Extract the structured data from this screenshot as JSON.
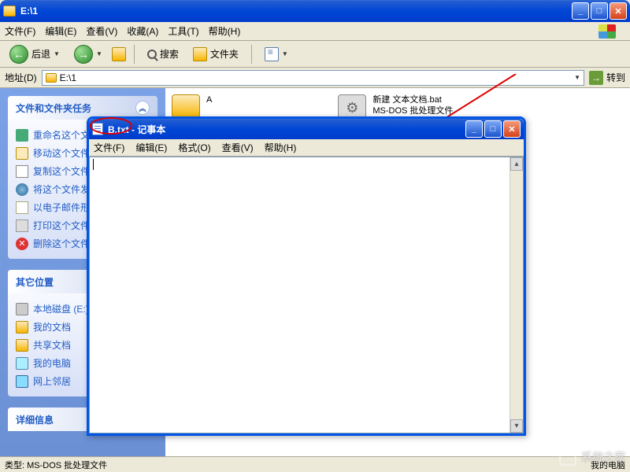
{
  "explorer": {
    "title": "E:\\1",
    "menus": [
      "文件(F)",
      "编辑(E)",
      "查看(V)",
      "收藏(A)",
      "工具(T)",
      "帮助(H)"
    ],
    "toolbar": {
      "back": "后退",
      "search": "搜索",
      "folders": "文件夹"
    },
    "address": {
      "label": "地址(D)",
      "value": "E:\\1",
      "go": "转到"
    },
    "sidebar": {
      "tasks": {
        "title": "文件和文件夹任务",
        "items": [
          "重命名这个文件",
          "移动这个文件",
          "复制这个文件",
          "将这个文件发布到 Web",
          "以电子邮件形式发送此文件",
          "打印这个文件",
          "删除这个文件"
        ]
      },
      "other": {
        "title": "其它位置",
        "items": [
          "本地磁盘 (E:)",
          "我的文档",
          "共享文档",
          "我的电脑",
          "网上邻居"
        ]
      },
      "details": {
        "title": "详细信息"
      }
    },
    "files": {
      "folder_a": "A",
      "bat_line1": "新建 文本文档.bat",
      "bat_line2": "MS-DOS 批处理文件"
    },
    "status": {
      "left": "类型: MS-DOS 批处理文件",
      "right": "我的电脑"
    }
  },
  "notepad": {
    "title": "B.txt - 记事本",
    "menus": [
      "文件(F)",
      "编辑(E)",
      "格式(O)",
      "查看(V)",
      "帮助(H)"
    ],
    "content": ""
  },
  "watermark": "系统之家"
}
